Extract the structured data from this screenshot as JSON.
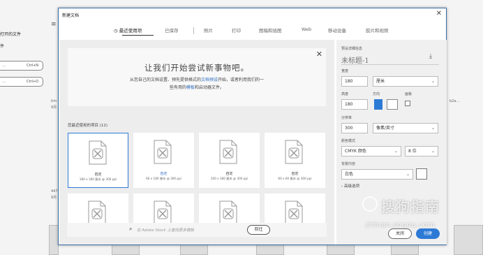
{
  "background": {
    "recent_title": "打开的文件",
    "recent_sub": "件",
    "shortcut1": "Ctrl+N",
    "shortcut2": "Ctrl+O",
    "menu_icon": "hamburger-icon",
    "thumb_label1": "tim",
    "thumb_sub1": "9月",
    "thumb_label2": "447",
    "thumb_sub2": "9月",
    "right_label": "b2a..."
  },
  "dialog": {
    "title": "新建文档",
    "tabs": [
      {
        "label": "最近使用项",
        "active": true
      },
      {
        "label": "已保存",
        "active": false
      },
      {
        "label": "照片",
        "active": false
      },
      {
        "label": "打印",
        "active": false
      },
      {
        "label": "图稿和插图",
        "active": false
      },
      {
        "label": "Web",
        "active": false
      },
      {
        "label": "移动设备",
        "active": false
      },
      {
        "label": "胶片和视频",
        "active": false
      }
    ],
    "banner": {
      "headline": "让我们开始尝试新事物吧。",
      "line1_a": "从您自己的文档设置、预先提供格式的",
      "line1_link": "文档预设",
      "line1_b": "开始，或者利用我们的一",
      "line2_a": "些有用的",
      "line2_link": "模板",
      "line2_b": "和启动器文件。"
    },
    "recent_label": "您最近使用的项目 (12)",
    "cards": [
      {
        "name": "自定",
        "dims": "180 x 180 厘米 @ 300 ppi",
        "selected": true
      },
      {
        "name": "自定",
        "dims": "60 x 180 厘米 @ 300 ppi",
        "selected": false
      },
      {
        "name": "自定",
        "dims": "100 x 180 厘米 @ 300 ppi",
        "selected": false
      },
      {
        "name": "自定",
        "dims": "60 x 60 厘米 @ 300 ppi",
        "selected": false
      }
    ],
    "search_placeholder": "在 Adobe Stock 上查找更多模板",
    "go_label": "前往",
    "details": {
      "section_label": "预设详细信息",
      "doc_name": "未标题-1",
      "width_label": "宽度",
      "width_value": "180",
      "width_unit": "厘米",
      "height_label": "高度",
      "height_value": "180",
      "orientation_label": "方向",
      "artboard_label": "画板",
      "resolution_label": "分辨率",
      "resolution_value": "300",
      "resolution_unit": "像素/英寸",
      "color_mode_label": "颜色模式",
      "color_mode_value": "CMYK 颜色",
      "bit_depth": "8 位",
      "bg_label": "背景内容",
      "bg_value": "白色",
      "advanced": "高级选项",
      "close_label": "关闭",
      "create_label": "创建"
    }
  },
  "watermark": {
    "text": "搜狗指南",
    "url": "zhinan.sogou.com"
  },
  "colors": {
    "accent": "#2d7ad6",
    "link": "#2d6fc2",
    "panel": "#ededed"
  }
}
